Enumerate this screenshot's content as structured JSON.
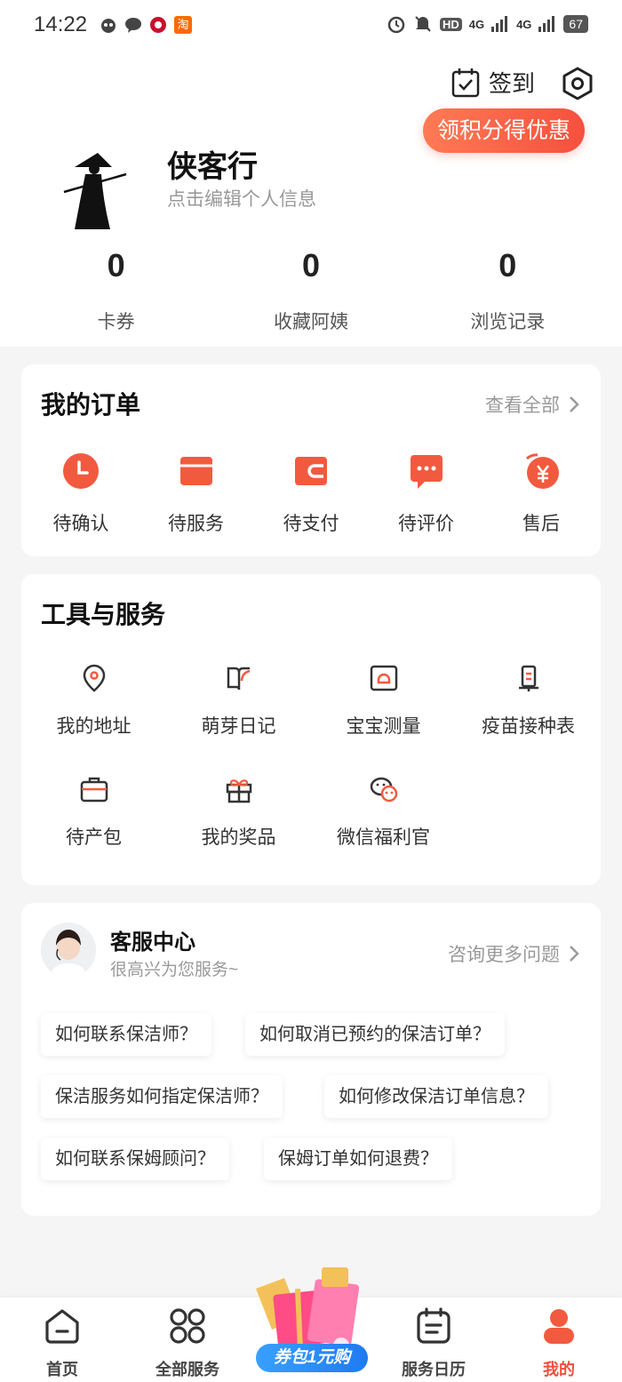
{
  "status_bar": {
    "time": "14:22",
    "battery": "67",
    "network_1": "4G",
    "network_2": "4G",
    "hd_label": "HD",
    "app_icon_taobao": "淘"
  },
  "profile": {
    "checkin_label": "签到",
    "promo_label": "领积分得优惠",
    "username": "侠客行",
    "edit_hint": "点击编辑个人信息",
    "stats": [
      {
        "value": "0",
        "label": "卡券"
      },
      {
        "value": "0",
        "label": "收藏阿姨"
      },
      {
        "value": "0",
        "label": "浏览记录"
      }
    ]
  },
  "orders": {
    "title": "我的订单",
    "view_all": "查看全部",
    "items": [
      {
        "label": "待确认",
        "icon": "clock-icon"
      },
      {
        "label": "待服务",
        "icon": "card-icon"
      },
      {
        "label": "待支付",
        "icon": "wallet-icon"
      },
      {
        "label": "待评价",
        "icon": "chat-icon"
      },
      {
        "label": "售后",
        "icon": "yuan-refund-icon"
      }
    ]
  },
  "tools": {
    "title": "工具与服务",
    "items": [
      {
        "label": "我的地址",
        "icon": "location-icon"
      },
      {
        "label": "萌芽日记",
        "icon": "book-icon"
      },
      {
        "label": "宝宝测量",
        "icon": "scale-icon"
      },
      {
        "label": "疫苗接种表",
        "icon": "vaccine-icon"
      },
      {
        "label": "待产包",
        "icon": "bag-icon"
      },
      {
        "label": "我的奖品",
        "icon": "gift-icon"
      },
      {
        "label": "微信福利官",
        "icon": "wechat-icon"
      }
    ]
  },
  "service": {
    "title": "客服中心",
    "subtitle": "很高兴为您服务~",
    "more": "咨询更多问题",
    "faqs": [
      "如何联系保洁师？",
      "如何取消已预约的保洁订单？",
      "保洁服务如何指定保洁师？",
      "如何修改保洁订单信息？",
      "如何联系保姆顾问？",
      "保姆订单如何退费？"
    ]
  },
  "bottom_nav": {
    "items": [
      {
        "label": "首页"
      },
      {
        "label": "全部服务"
      },
      {
        "label": "服务日历"
      },
      {
        "label": "我的"
      }
    ],
    "promo_label": "券包1元购",
    "active_index": 3
  },
  "colors": {
    "accent": "#f04e3e",
    "promo_gradient_start": "#ff7a55",
    "promo_gradient_end": "#f5503e"
  }
}
